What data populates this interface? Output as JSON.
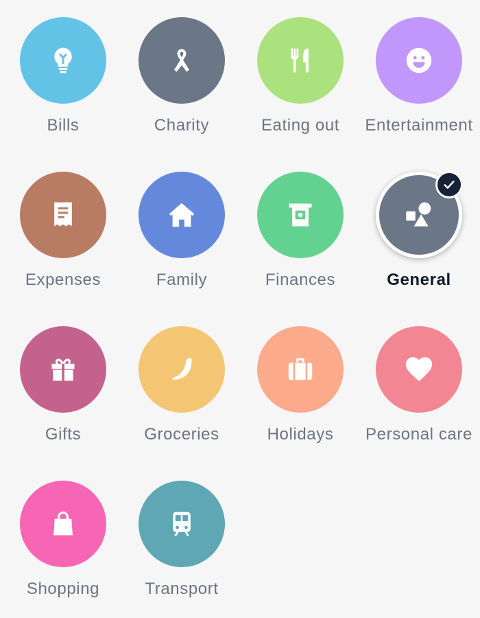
{
  "categories": [
    {
      "label": "Bills",
      "icon": "lightbulb-icon",
      "color": "#62c3e6"
    },
    {
      "label": "Charity",
      "icon": "ribbon-icon",
      "color": "#6b7686"
    },
    {
      "label": "Eating out",
      "icon": "fork-knife-icon",
      "color": "#ace27d"
    },
    {
      "label": "Entertainment",
      "icon": "smiley-icon",
      "color": "#c297fb"
    },
    {
      "label": "Expenses",
      "icon": "receipt-icon",
      "color": "#b87b63"
    },
    {
      "label": "Family",
      "icon": "home-icon",
      "color": "#6489dc"
    },
    {
      "label": "Finances",
      "icon": "atm-cash-icon",
      "color": "#63d291"
    },
    {
      "label": "General",
      "icon": "shapes-icon",
      "color": "#6b7686",
      "selected": true
    },
    {
      "label": "Gifts",
      "icon": "gift-icon",
      "color": "#c4628e"
    },
    {
      "label": "Groceries",
      "icon": "banana-icon",
      "color": "#f4c674"
    },
    {
      "label": "Holidays",
      "icon": "suitcase-icon",
      "color": "#fbaa8b"
    },
    {
      "label": "Personal care",
      "icon": "heart-icon",
      "color": "#f38693"
    },
    {
      "label": "Shopping",
      "icon": "shopping-bag-icon",
      "color": "#f766b5"
    },
    {
      "label": "Transport",
      "icon": "train-icon",
      "color": "#5fa7b4"
    }
  ]
}
